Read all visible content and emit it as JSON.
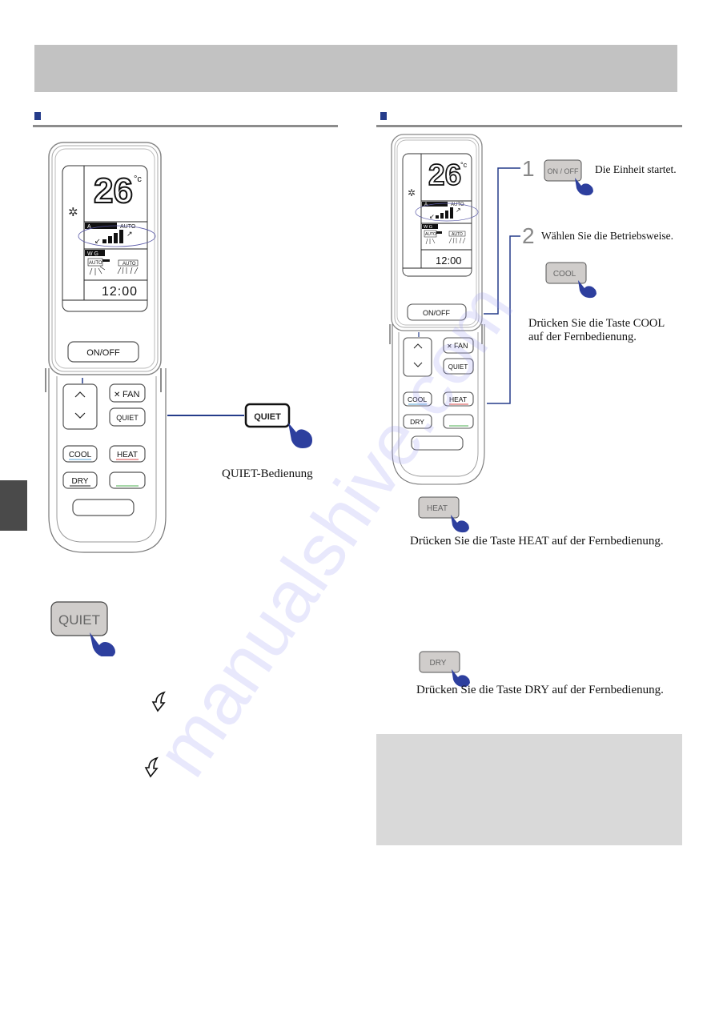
{
  "header": {
    "title": ""
  },
  "left_section": {
    "heading": "",
    "callout_button": "QUIET",
    "callout_caption": "QUIET-Bedienung",
    "large_button": "QUIET"
  },
  "right_section": {
    "heading": "",
    "steps": [
      {
        "number": "1",
        "button": "ON / OFF",
        "text": "Die Einheit startet."
      },
      {
        "number": "2",
        "text": "Wählen Sie die Betriebsweise."
      }
    ],
    "cool": {
      "button": "COOL",
      "line1": "Drücken Sie die Taste COOL",
      "line2": "auf der Fernbedienung."
    },
    "heat": {
      "button": "HEAT",
      "text": "Drücken Sie die Taste HEAT auf der Fernbedienung."
    },
    "dry": {
      "button": "DRY",
      "text": "Drücken Sie die Taste DRY auf der Fernbedienung."
    },
    "note_box": ""
  },
  "remote": {
    "display": {
      "temperature": "26",
      "unit": "°c",
      "fan_label_left": "A",
      "fan_label_right": "AUTO",
      "swing_label": "W  G",
      "louver_auto_1": "AUTO",
      "louver_auto_2": "AUTO",
      "clock": "12:00",
      "mode_icon": "snowflake-icon"
    },
    "buttons": {
      "onoff": "ON/OFF",
      "fan": "FAN",
      "quiet": "QUIET",
      "cool": "COOL",
      "heat": "HEAT",
      "dry": "DRY",
      "up": "^",
      "down": "v"
    },
    "underline_colors": {
      "cool": "#5aa7d8",
      "heat": "#d84a4a",
      "dry": "#222222",
      "blank": "#4caf50"
    }
  },
  "colors": {
    "accent": "#253c8a",
    "hand": "#2d3f9e",
    "header_band": "#c2c2c2",
    "note_box": "#d9d9d9",
    "side_tab": "#4a4a4a"
  },
  "watermark": "manualshive.com"
}
